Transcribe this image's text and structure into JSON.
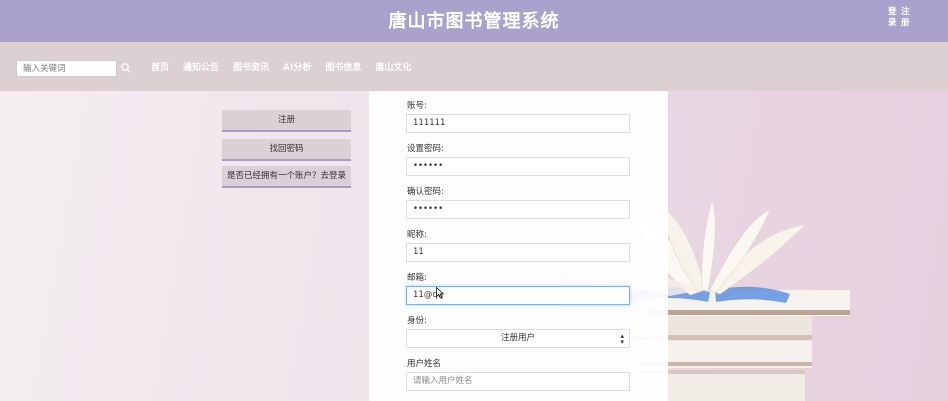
{
  "header": {
    "title": "唐山市图书管理系统",
    "login": [
      "登",
      "录"
    ],
    "register": [
      "注",
      "册"
    ]
  },
  "search": {
    "placeholder": "输入关键词"
  },
  "nav": {
    "items": [
      "首页",
      "通知公告",
      "图书资讯",
      "AI分析",
      "图书信息",
      "唐山文化"
    ]
  },
  "side_buttons": {
    "register": "注册",
    "forgot_password": "找回密码",
    "have_account": "是否已经拥有一个账户？去登录"
  },
  "form": {
    "account": {
      "label": "账号:",
      "value": "111111"
    },
    "password": {
      "label": "设置密码:",
      "value": "••••••"
    },
    "confirm_password": {
      "label": "确认密码:",
      "value": "••••••"
    },
    "nickname": {
      "label": "昵称:",
      "value": "11"
    },
    "email": {
      "label": "邮箱:",
      "value": "11@qq"
    },
    "role": {
      "label": "身份:",
      "value": "注册用户"
    },
    "real_name": {
      "label": "用户姓名",
      "placeholder": "请输入用户姓名"
    }
  },
  "colors": {
    "header_bg": "#a9a2cc",
    "nav_bg": "#ddd0d3",
    "button_bg": "#dccfd6",
    "accent_border": "#a99bc6",
    "active_field_border": "#7fb0e8"
  }
}
